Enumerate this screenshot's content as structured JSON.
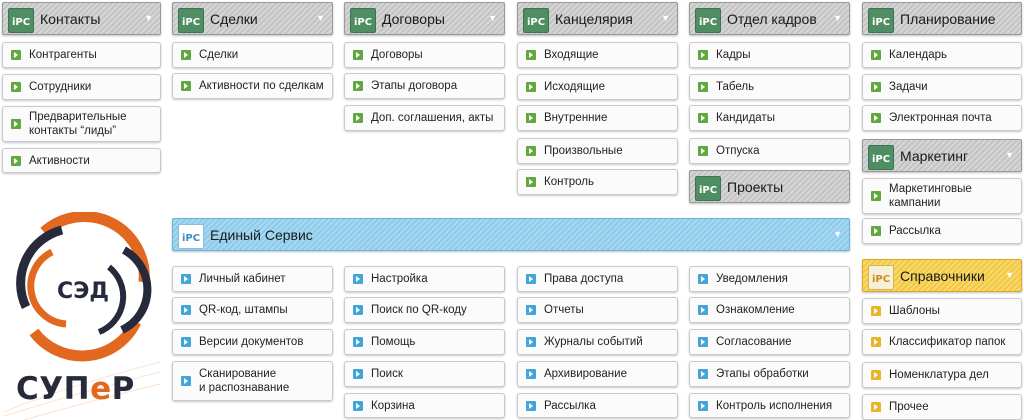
{
  "modules": [
    {
      "id": "contacts",
      "title": "Контакты",
      "has_chevron": true,
      "items": [
        "Контрагенты",
        "Сотрудники",
        "Предварительные\nконтакты “лиды”",
        "Активности"
      ]
    },
    {
      "id": "deals",
      "title": "Сделки",
      "has_chevron": true,
      "items": [
        "Сделки",
        "Активности по сделкам"
      ]
    },
    {
      "id": "contracts",
      "title": "Договоры",
      "has_chevron": true,
      "items": [
        "Договоры",
        "Этапы договора",
        "Доп. соглашения, акты"
      ]
    },
    {
      "id": "office",
      "title": "Канцелярия",
      "has_chevron": true,
      "items": [
        "Входящие",
        "Исходящие",
        "Внутренние",
        "Произвольные",
        "Контроль"
      ]
    },
    {
      "id": "hr",
      "title": "Отдел кадров",
      "has_chevron": true,
      "items": [
        "Кадры",
        "Табель",
        "Кандидаты",
        "Отпуска"
      ]
    },
    {
      "id": "projects",
      "title": "Проекты",
      "has_chevron": false,
      "items": []
    },
    {
      "id": "planning",
      "title": "Планирование",
      "has_chevron": false,
      "items": [
        "Календарь",
        "Задачи",
        "Электронная почта"
      ]
    },
    {
      "id": "marketing",
      "title": "Маркетинг",
      "has_chevron": true,
      "items": [
        "Маркетинговые\nкампании",
        "Рассылка"
      ]
    },
    {
      "id": "reference",
      "title": "Справочники",
      "has_chevron": true,
      "items": [
        "Шаблоны",
        "Классификатор папок",
        "Номенклатура дел",
        "Прочее"
      ]
    }
  ],
  "service": {
    "title": "Единый Сервис",
    "columns": [
      [
        "Личный кабинет",
        "QR-код, штампы",
        "Версии документов",
        "Сканирование\nи распознавание"
      ],
      [
        "Настройка",
        "Поиск по QR-коду",
        "Помощь",
        "Поиск",
        "Корзина"
      ],
      [
        "Права доступа",
        "Отчеты",
        "Журналы событий",
        "Архивирование",
        "Рассылка"
      ],
      [
        "Уведомления",
        "Ознакомление",
        "Согласование",
        "Этапы обработки",
        "Контроль исполнения"
      ]
    ]
  },
  "brand": {
    "ring_text": "СЭД",
    "name_part1": "СУП",
    "name_accent": "е",
    "name_part2": "Р"
  },
  "colors": {
    "green": "#61a840",
    "blue": "#43a6d8",
    "yellow": "#e6b62a",
    "orange": "#e2681f",
    "navy": "#262a3b"
  },
  "icons": {
    "header_logo": "ipc-logo-icon",
    "item_bullet": "arrow-bullet-icon",
    "chevron": "chevron-down-icon"
  }
}
